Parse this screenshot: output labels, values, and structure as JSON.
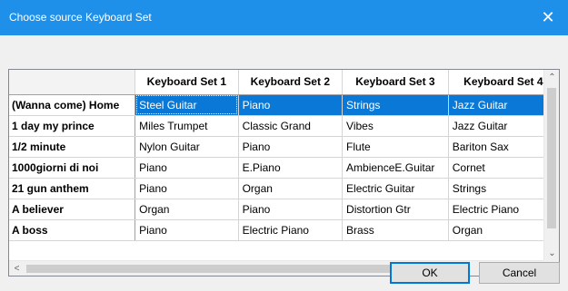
{
  "window": {
    "title": "Choose source Keyboard Set",
    "close_glyph": "✕"
  },
  "table": {
    "columns": [
      "Keyboard Set 1",
      "Keyboard Set 2",
      "Keyboard Set 3",
      "Keyboard Set 4"
    ],
    "selected_row": 0,
    "rows": [
      {
        "song": "(Wanna come) Home",
        "sets": [
          "Steel Guitar",
          "Piano",
          "Strings",
          "Jazz Guitar"
        ]
      },
      {
        "song": "1 day my prince",
        "sets": [
          "Miles Trumpet",
          "Classic Grand",
          "Vibes",
          "Jazz Guitar"
        ]
      },
      {
        "song": "1/2 minute",
        "sets": [
          "Nylon Guitar",
          "Piano",
          "Flute",
          "Bariton Sax"
        ]
      },
      {
        "song": "1000giorni di noi",
        "sets": [
          "Piano",
          "E.Piano",
          "AmbienceE.Guitar",
          "Cornet"
        ]
      },
      {
        "song": "21 gun anthem",
        "sets": [
          "Piano",
          "Organ",
          "Electric Guitar",
          "Strings"
        ]
      },
      {
        "song": "A believer",
        "sets": [
          "Organ",
          "Piano",
          "Distortion Gtr",
          "Electric Piano"
        ]
      },
      {
        "song": "A boss",
        "sets": [
          "Piano",
          "Electric Piano",
          "Brass",
          "Organ"
        ]
      }
    ]
  },
  "scrollbars": {
    "up_glyph": "⌃",
    "down_glyph": "⌄",
    "left_glyph": "<",
    "right_glyph": ">"
  },
  "buttons": {
    "ok": "OK",
    "cancel": "Cancel"
  },
  "colors": {
    "titlebar": "#1e90ea",
    "selection": "#0a78d7"
  }
}
